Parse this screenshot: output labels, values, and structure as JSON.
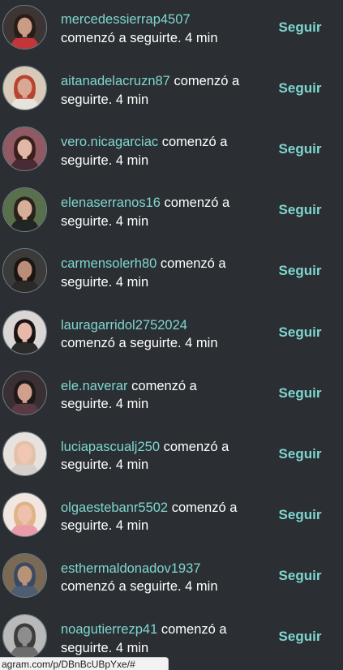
{
  "notifications": [
    {
      "username": "mercedessierrap4507",
      "message": "comenzó a seguirte. 4 min",
      "action": "Seguir",
      "avatar": {
        "bg": "#3c3533",
        "skin": "#c99c84",
        "hair": "#2a1c17",
        "cloth": "#c2363a"
      }
    },
    {
      "username": "aitanadelacruzn87",
      "message": " comenzó a seguirte. 4 min",
      "action": "Seguir",
      "avatar": {
        "bg": "#d9c9b8",
        "skin": "#d9a892",
        "hair": "#b7442f",
        "cloth": "#e6e2dc"
      }
    },
    {
      "username": "vero.nicagarciac",
      "message": " comenzó a seguirte. 4 min",
      "action": "Seguir",
      "avatar": {
        "bg": "#8f5a63",
        "skin": "#e1b7a5",
        "hair": "#3b1f1a",
        "cloth": "#4a2b35"
      }
    },
    {
      "username": "elenaserranos16",
      "message": " comenzó a seguirte. 4 min",
      "action": "Seguir",
      "avatar": {
        "bg": "#58704b",
        "skin": "#d7ae98",
        "hair": "#2b211c",
        "cloth": "#1f2624"
      }
    },
    {
      "username": "carmensolerh80",
      "message": " comenzó a seguirte. 4 min",
      "action": "Seguir",
      "avatar": {
        "bg": "#3b3b3a",
        "skin": "#b98d77",
        "hair": "#1d1513",
        "cloth": "#2c2a28"
      }
    },
    {
      "username": "lauragarridol2752024",
      "message": "comenzó a seguirte. 4 min",
      "action": "Seguir",
      "avatar": {
        "bg": "#d9d6d5",
        "skin": "#e6b9a8",
        "hair": "#1a1414",
        "cloth": "#2b2b2b"
      }
    },
    {
      "username": "ele.naverar",
      "message": " comenzó a seguirte. 4 min",
      "action": "Seguir",
      "avatar": {
        "bg": "#3a2f33",
        "skin": "#d1a08c",
        "hair": "#20191a",
        "cloth": "#5a3a44"
      }
    },
    {
      "username": "luciapascualj250",
      "message": " comenzó a seguirte. 4 min",
      "action": "Seguir",
      "avatar": {
        "bg": "#e8e2df",
        "skin": "#f0c6b5",
        "hair": "#e2c3a9",
        "cloth": "#d7cfca"
      }
    },
    {
      "username": "olgaestebanr5502",
      "message": " comenzó a seguirte. 4 min",
      "action": "Seguir",
      "avatar": {
        "bg": "#f1e7e0",
        "skin": "#eec1ac",
        "hair": "#e0b488",
        "cloth": "#ea9aa8"
      }
    },
    {
      "username": "esthermaldonadov1937",
      "message": "comenzó a seguirte. 4 min",
      "action": "Seguir",
      "avatar": {
        "bg": "#7a6a55",
        "skin": "#b89377",
        "hair": "#3a4a63",
        "cloth": "#4e5d74"
      }
    },
    {
      "username": "noagutierrezp41",
      "message": " comenzó a seguirte. 4 min",
      "action": "Seguir",
      "avatar": {
        "bg": "#b9b9b9",
        "skin": "#8d8d8d",
        "hair": "#3d3d3d",
        "cloth": "#6c6c6c"
      }
    }
  ],
  "status_bar": {
    "url": "agram.com/p/DBnBcUBpYxe/#"
  }
}
